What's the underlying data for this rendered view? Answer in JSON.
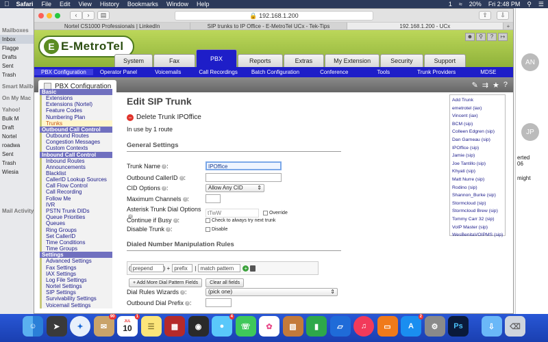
{
  "menubar": {
    "items": [
      "Safari",
      "File",
      "Edit",
      "View",
      "History",
      "Bookmarks",
      "Window",
      "Help"
    ],
    "right": [
      "1",
      "20%",
      "Fri 2:48 PM"
    ]
  },
  "mail": {
    "sidebar": [
      "Mailboxes",
      "Inbox",
      "Flagge",
      "Drafts",
      "Sent",
      "Trash",
      "Smart Mailbo",
      "On My Mac",
      "Yahoo!",
      "Bulk M",
      "Draft",
      "Nortel",
      "roadwa",
      "Sent",
      "Trash",
      "Wiesia",
      "Mail Activity"
    ],
    "avatars": [
      "AN",
      "JP"
    ],
    "snippets": [
      "erted",
      "06",
      "might"
    ]
  },
  "browser": {
    "url": "192.168.1.200",
    "tabs": [
      "Nortel CS1000 Professionals | LinkedIn",
      "SIP trunks to IP Office - E-MetroTel UCx - Tek-Tips",
      "192.168.1.200 - UCx"
    ]
  },
  "app": {
    "logo": "E-MetroTel",
    "main_tabs": [
      "System",
      "Fax",
      "PBX",
      "Reports",
      "Extras",
      "My Extension",
      "Security",
      "Support"
    ],
    "active_main_tab": "PBX",
    "sub_nav": [
      "PBX Configuration",
      "Operator Panel",
      "Voicemails",
      "Call Recordings",
      "Batch Configuration",
      "Conference",
      "Tools",
      "Trunk Providers",
      "MDSE"
    ],
    "page_tab": "PBX Configuration"
  },
  "leftmenu": {
    "sections": [
      {
        "title": "Basic",
        "items": [
          "Extensions",
          "Extensions (Nortel)",
          "Feature Codes",
          "Numbering Plan",
          "Trunks"
        ]
      },
      {
        "title": "Outbound Call Control",
        "items": [
          "Outbound Routes",
          "Congestion Messages",
          "Custom Contexts"
        ]
      },
      {
        "title": "Inbound Call Control",
        "items": [
          "Inbound Routes",
          "Announcements",
          "Blacklist",
          "CallerID Lookup Sources",
          "Call Flow Control",
          "Call Recording",
          "Follow Me",
          "IVR",
          "PSTN Trunk DIDs",
          "Queue Priorities",
          "Queues",
          "Ring Groups",
          "Set CallerID",
          "Time Conditions",
          "Time Groups"
        ]
      },
      {
        "title": "Settings",
        "items": [
          "Advanced Settings",
          "Fax Settings",
          "IAX Settings",
          "Log File Settings",
          "Nortel Settings",
          "SIP Settings",
          "Survivability Settings",
          "Voicemail Settings"
        ]
      }
    ]
  },
  "form": {
    "title": "Edit SIP Trunk",
    "delete_label": "Delete Trunk IPOffice",
    "in_use": "In use by 1 route",
    "general_settings": "General Settings",
    "trunk_name_label": "Trunk Name",
    "trunk_name_value": "IPOffice",
    "outbound_callerid_label": "Outbound CallerID",
    "cid_options_label": "CID Options",
    "cid_options_value": "Allow Any CID",
    "max_channels_label": "Maximum Channels",
    "dial_options_label": "Asterisk Trunk Dial Options",
    "dial_options_value": "tTwW",
    "override_label": "Override",
    "continue_busy_label": "Continue if Busy",
    "continue_busy_text": "Check to always try next trunk",
    "disable_trunk_label": "Disable Trunk",
    "disable_text": "Disable",
    "dialed_rules": "Dialed Number Manipulation Rules",
    "prepend_placeholder": "prepend",
    "prefix_placeholder": "prefix",
    "match_placeholder": "match pattern",
    "add_more_btn": "+ Add More Dial Pattern Fields",
    "clear_btn": "Clear all fields",
    "wizards_label": "Dial Rules Wizards",
    "wizards_value": "(pick one)",
    "outbound_prefix_label": "Outbound Dial Prefix"
  },
  "trunks": [
    "Add Trunk",
    "emetrotel (iax)",
    "Vincent (iax)",
    "BCM (sip)",
    "Colleen Edgren (sip)",
    "Dan Garneau (sip)",
    "IPOffice (sip)",
    "Jamie (sip)",
    "Joe Tantillo (sip)",
    "Khyati (sip)",
    "Matt Nurre (sip)",
    "Rodino (sip)",
    "Shannon_Burke (sip)",
    "Stormcloud (sip)",
    "Stormcloud Brew (sip)",
    "Tommy Carr 32 (sip)",
    "VoIP Master (sip)",
    "WesBenitaVOIPMS (sip)"
  ],
  "dock": {
    "badges": {
      "calendar_day": "10",
      "mail": "90",
      "calendar_badge": "1",
      "messages": "4",
      "appstore": "2"
    },
    "calendar_month": "JUL"
  }
}
